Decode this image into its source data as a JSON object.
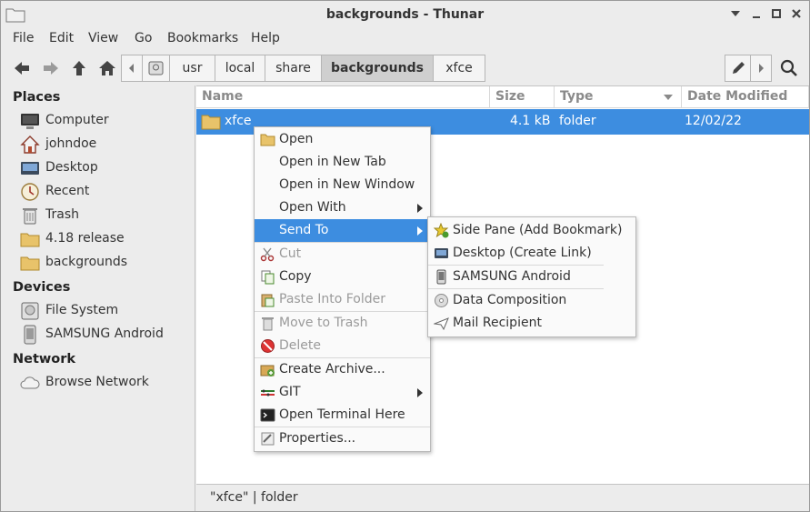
{
  "window": {
    "title": "backgrounds - Thunar",
    "controls": [
      "minimize-icon",
      "restore-icon",
      "maximize-icon",
      "close-icon"
    ]
  },
  "menubar": [
    "File",
    "Edit",
    "View",
    "Go",
    "Bookmarks",
    "Help"
  ],
  "toolbar": {
    "icons": [
      "back-icon",
      "forward-icon",
      "up-icon",
      "home-icon"
    ],
    "path": [
      "usr",
      "local",
      "share",
      "backgrounds",
      "xfce"
    ],
    "active_crumb": "backgrounds"
  },
  "sidebar": {
    "places_title": "Places",
    "places": [
      {
        "label": "Computer",
        "icon": "computer-icon"
      },
      {
        "label": "johndoe",
        "icon": "home-folder-icon"
      },
      {
        "label": "Desktop",
        "icon": "desktop-icon"
      },
      {
        "label": "Recent",
        "icon": "recent-icon"
      },
      {
        "label": "Trash",
        "icon": "trash-icon"
      },
      {
        "label": "4.18 release",
        "icon": "folder-icon"
      },
      {
        "label": "backgrounds",
        "icon": "folder-icon"
      }
    ],
    "devices_title": "Devices",
    "devices": [
      {
        "label": "File System",
        "icon": "harddisk-icon"
      },
      {
        "label": "SAMSUNG Android",
        "icon": "phone-icon"
      }
    ],
    "network_title": "Network",
    "network": [
      {
        "label": "Browse Network",
        "icon": "network-icon"
      }
    ]
  },
  "columns": {
    "name": "Name",
    "size": "Size",
    "type": "Type",
    "date": "Date Modified"
  },
  "files": [
    {
      "name": "xfce",
      "size": "4.1  kB",
      "type": "folder",
      "date": "12/02/22"
    }
  ],
  "context_menu": [
    {
      "label": "Open",
      "icon": "folder-open-icon"
    },
    {
      "label": "Open in New Tab"
    },
    {
      "label": "Open in New Window"
    },
    {
      "label": "Open With",
      "submenu": true
    },
    {
      "label": "Send To",
      "submenu": true,
      "highlighted": true
    },
    {
      "label": "Cut",
      "icon": "scissors-icon",
      "disabled": true
    },
    {
      "label": "Copy",
      "icon": "copy-icon"
    },
    {
      "label": "Paste Into Folder",
      "icon": "paste-icon",
      "disabled": true
    },
    {
      "label": "Move to Trash",
      "icon": "trash-icon",
      "disabled": true
    },
    {
      "label": "Delete",
      "icon": "delete-icon",
      "disabled": true
    },
    {
      "label": "Create Archive...",
      "icon": "archive-icon"
    },
    {
      "label": "GIT",
      "icon": "git-icon",
      "submenu": true
    },
    {
      "label": "Open Terminal Here",
      "icon": "terminal-icon"
    },
    {
      "label": "Properties...",
      "icon": "properties-icon"
    }
  ],
  "send_to_menu": [
    {
      "label": "Side Pane (Add Bookmark)",
      "icon": "bookmark-add-icon"
    },
    {
      "label": "Desktop (Create Link)",
      "icon": "desktop-link-icon"
    },
    {
      "label": "SAMSUNG Android",
      "icon": "phone-icon"
    },
    {
      "label": "Data Composition",
      "icon": "disc-icon"
    },
    {
      "label": "Mail Recipient",
      "icon": "mail-send-icon"
    }
  ],
  "statusbar": "\"xfce\"  |  folder",
  "colors": {
    "selection": "#3d8de0",
    "folder": "#e8c36a"
  }
}
